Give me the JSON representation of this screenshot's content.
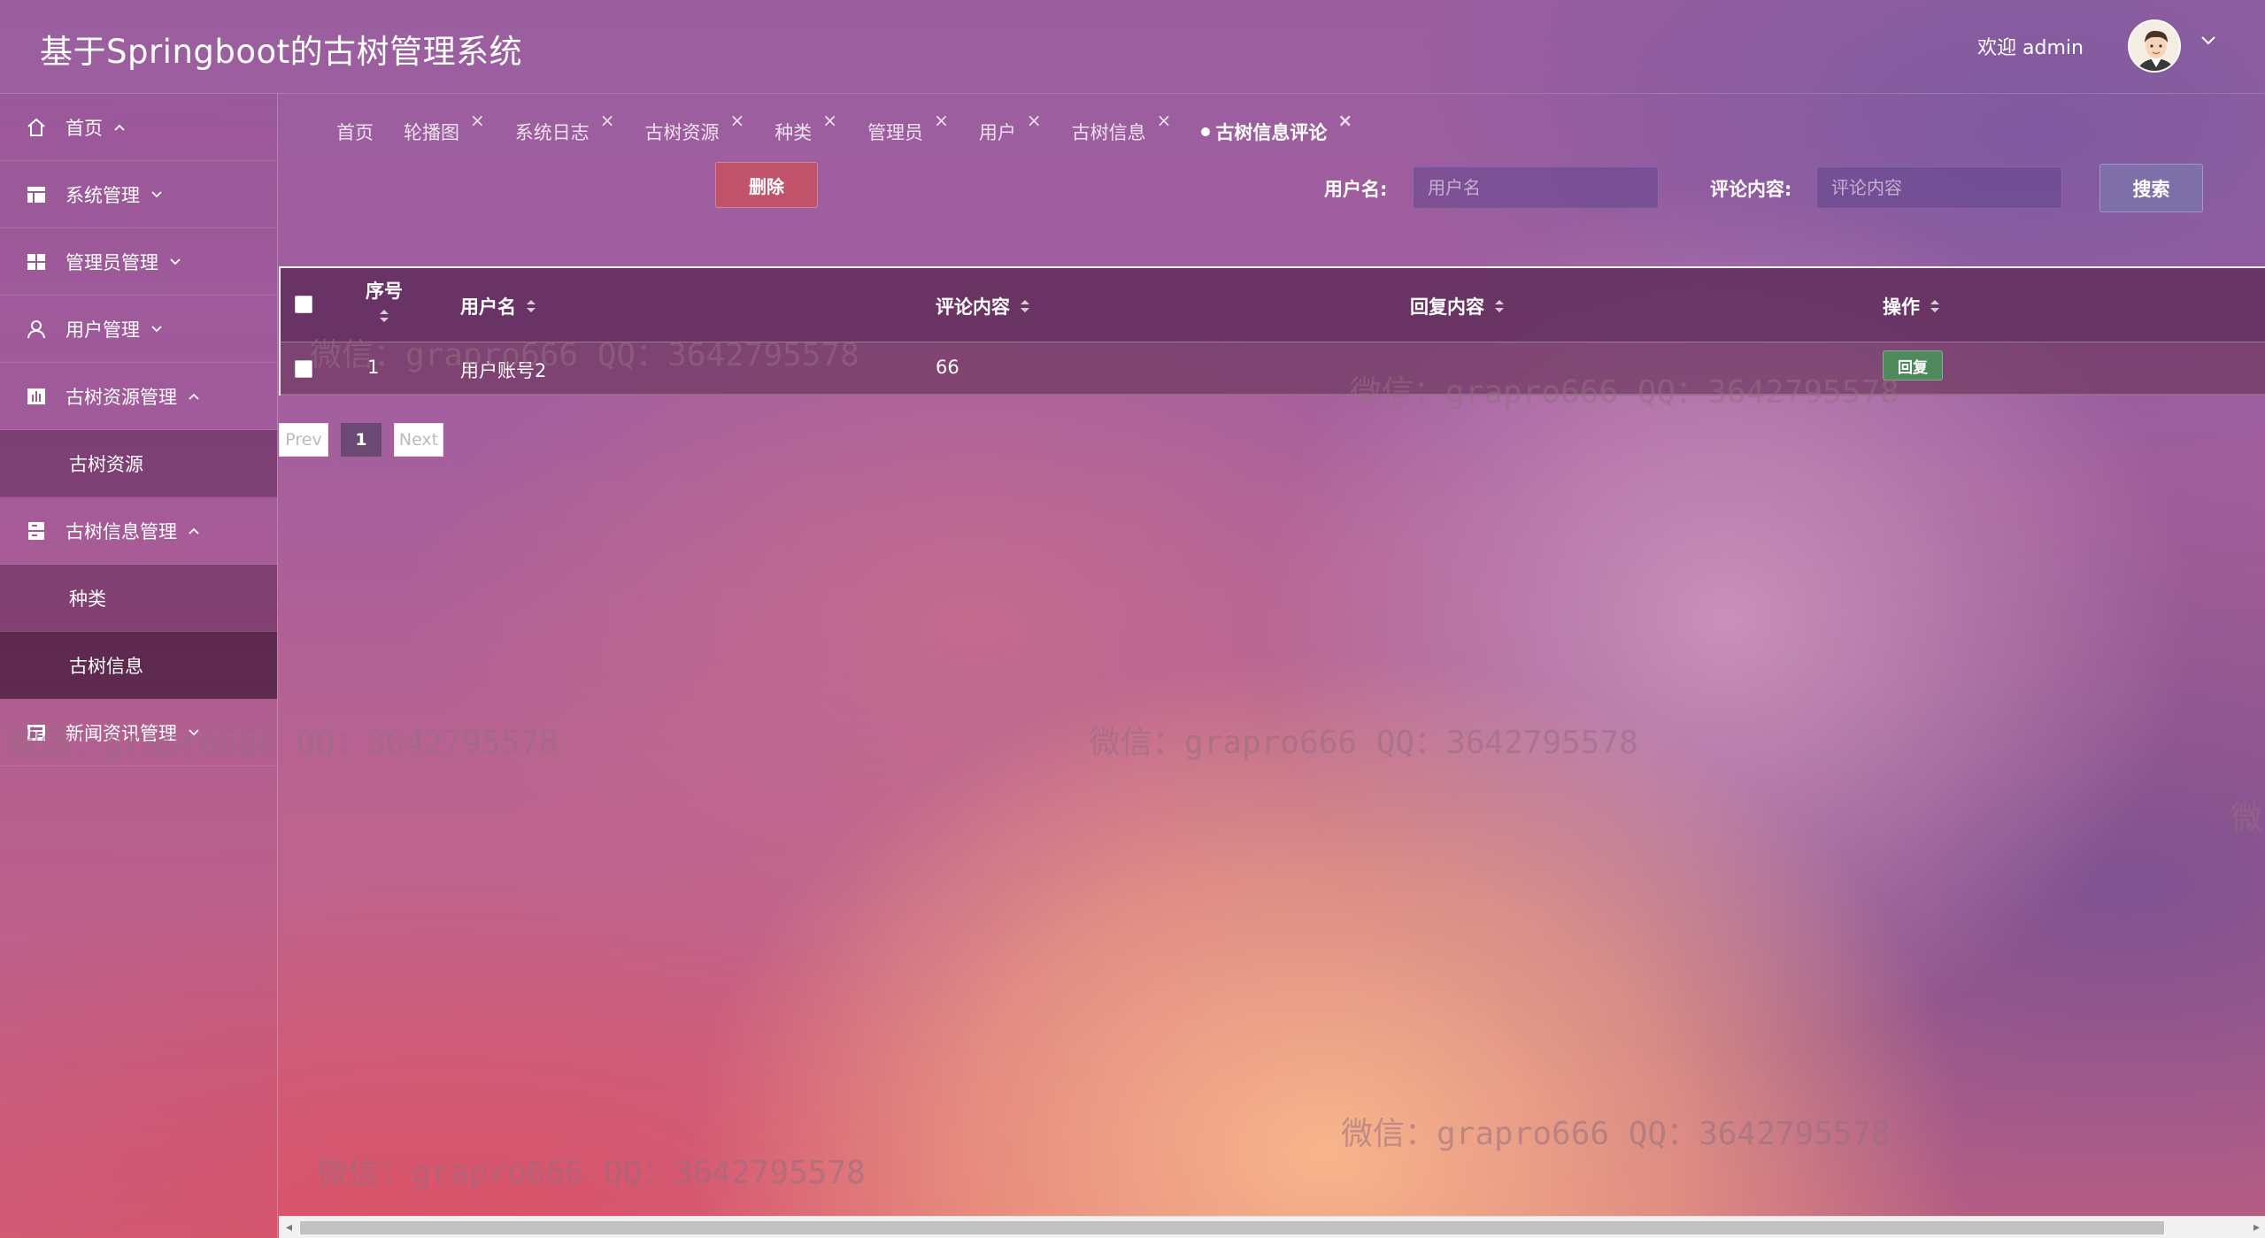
{
  "app": {
    "title": "基于Springboot的古树管理系统",
    "welcome": "欢迎 admin"
  },
  "sidebar": {
    "items": [
      {
        "label": "首页",
        "icon": "home-icon"
      },
      {
        "label": "系统管理",
        "icon": "layout-icon"
      },
      {
        "label": "管理员管理",
        "icon": "grid-icon"
      },
      {
        "label": "用户管理",
        "icon": "user-icon"
      },
      {
        "label": "古树资源管理",
        "icon": "chart-icon",
        "children": [
          "古树资源"
        ]
      },
      {
        "label": "古树信息管理",
        "icon": "database-icon",
        "children": [
          "种类",
          "古树信息"
        ]
      },
      {
        "label": "新闻资讯管理",
        "icon": "news-icon"
      }
    ]
  },
  "tabs": [
    {
      "label": "首页"
    },
    {
      "label": "轮播图"
    },
    {
      "label": "系统日志"
    },
    {
      "label": "古树资源"
    },
    {
      "label": "种类"
    },
    {
      "label": "管理员"
    },
    {
      "label": "用户"
    },
    {
      "label": "古树信息"
    },
    {
      "label": "古树信息评论",
      "active": true
    }
  ],
  "toolbar": {
    "delete_label": "删除",
    "username_label": "用户名:",
    "username_placeholder": "用户名",
    "comment_label": "评论内容:",
    "comment_placeholder": "评论内容",
    "search_label": "搜索"
  },
  "table": {
    "headers": [
      "序号",
      "用户名",
      "评论内容",
      "回复内容",
      "操作"
    ],
    "rows": [
      {
        "index": "1",
        "username": "用户账号2",
        "comment": "66",
        "reply": "",
        "action_label": "回复"
      }
    ]
  },
  "pager": {
    "prev": "Prev",
    "current": "1",
    "next": "Next"
  },
  "watermark": "微信：grapro666 QQ：3642795578",
  "colors": {
    "delete_button": "#c0526a",
    "search_button": "#7e6fa8",
    "reply_button": "#4f8a5c",
    "table_header": "#5f2d5a"
  }
}
